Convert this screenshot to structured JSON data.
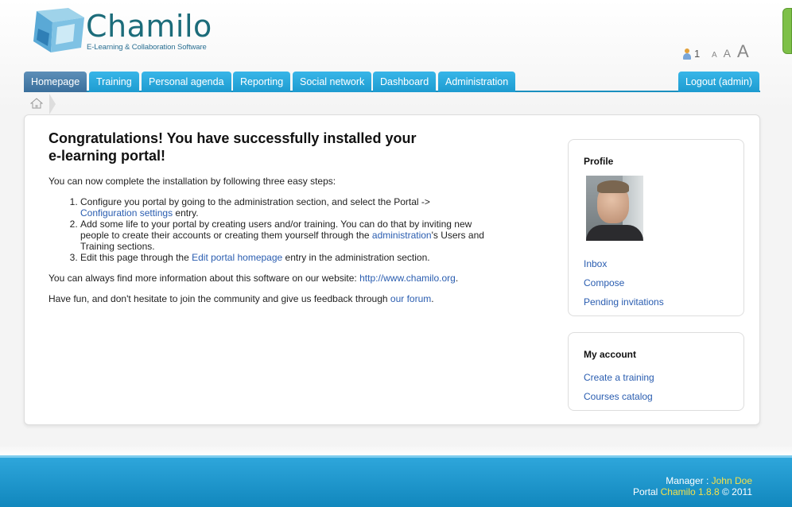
{
  "header": {
    "logo_title": "Chamilo",
    "logo_subtitle": "E-Learning & Collaboration Software",
    "online_users_count": "1",
    "font_sizes": [
      "A",
      "A",
      "A"
    ]
  },
  "nav": {
    "tabs": [
      {
        "label": "Homepage",
        "active": true
      },
      {
        "label": "Training"
      },
      {
        "label": "Personal agenda"
      },
      {
        "label": "Reporting"
      },
      {
        "label": "Social network"
      },
      {
        "label": "Dashboard"
      },
      {
        "label": "Administration"
      }
    ],
    "logout_label": "Logout (admin)"
  },
  "main": {
    "title": "Congratulations! You have successfully installed your e-learning portal!",
    "intro": "You can now complete the installation by following three easy steps:",
    "steps": {
      "s1_pre": "Configure you portal by going to the administration section, and select the Portal ->",
      "s1_link": "Configuration settings",
      "s1_post": " entry.",
      "s2_pre": "Add some life to your portal by creating users and/or training. You can do that by inviting new people to create their accounts or creating them yourself through the ",
      "s2_link": "administration",
      "s2_post": "'s Users and Training sections.",
      "s3_pre": "Edit this page through the ",
      "s3_link": "Edit portal homepage",
      "s3_post": " entry in the administration section."
    },
    "info_pre": "You can always find more information about this software on our website: ",
    "info_link": "http://www.chamilo.org",
    "info_post": ".",
    "fun_pre": "Have fun, and don't hesitate to join the community and give us feedback through ",
    "fun_link": "our forum",
    "fun_post": "."
  },
  "profile": {
    "heading": "Profile",
    "links": [
      "Inbox",
      "Compose",
      "Pending invitations"
    ]
  },
  "account": {
    "heading": "My account",
    "links": [
      "Create a training",
      "Courses catalog"
    ]
  },
  "footer": {
    "manager_label": "Manager : ",
    "manager_name": "John Doe",
    "portal_label": "Portal ",
    "portal_name": "Chamilo 1.8.8",
    "copyright": " © 2011"
  },
  "colors": {
    "nav_tab": "#1d9bd0",
    "nav_active": "#3a6f9c",
    "link": "#2a5db0",
    "footer": "#1187bd",
    "footer_highlight": "#f5e14a"
  }
}
